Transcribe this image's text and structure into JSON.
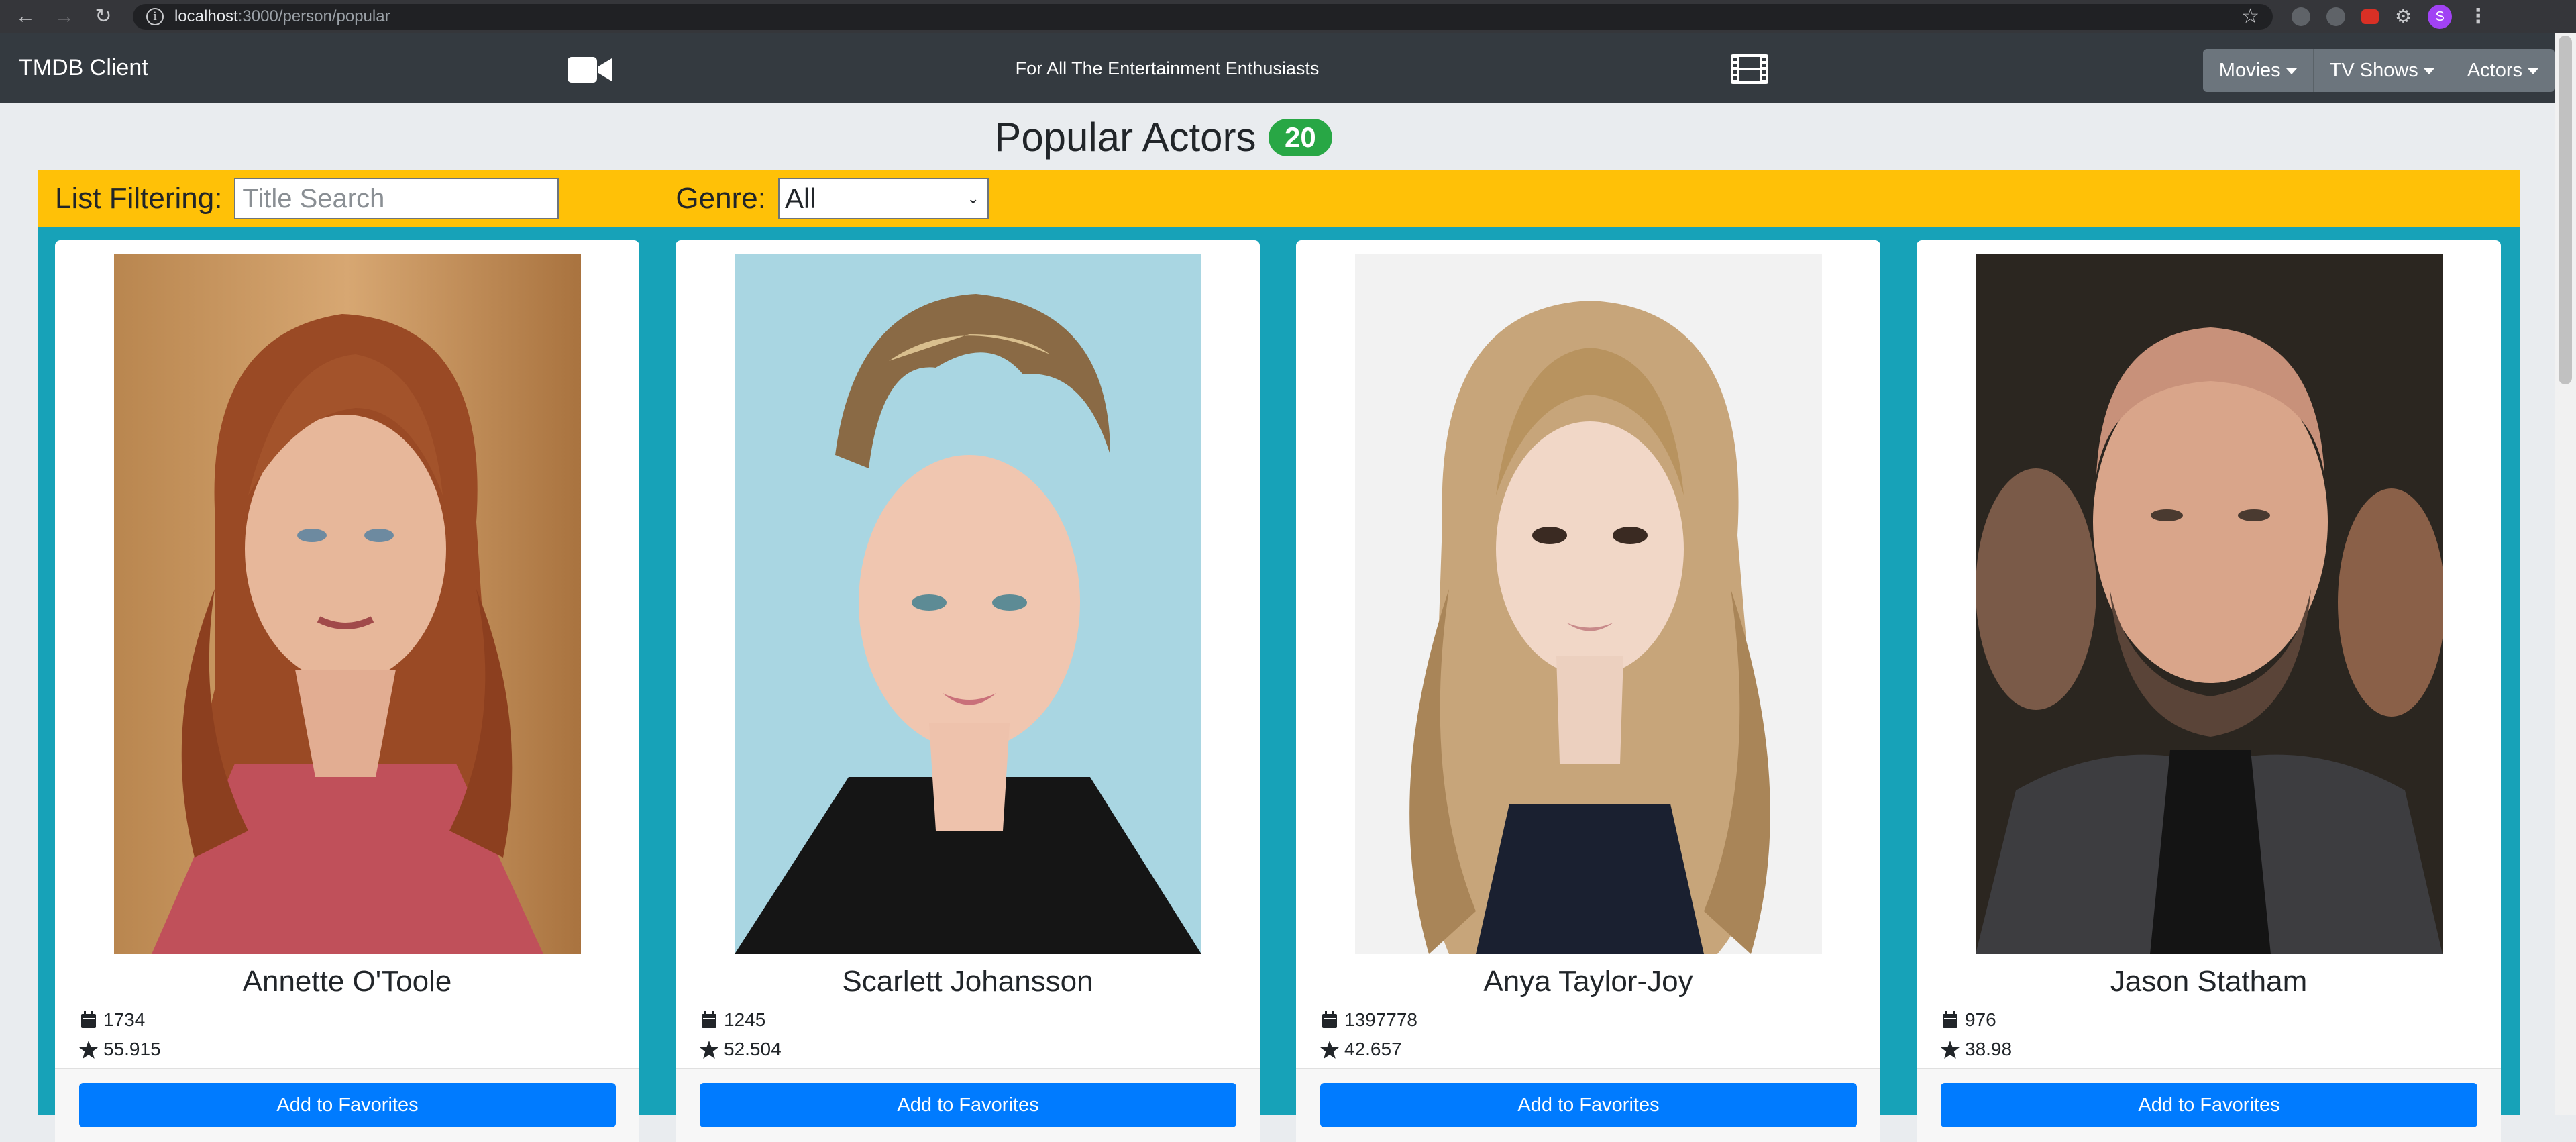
{
  "browser": {
    "url_host": "localhost",
    "url_path": ":3000/person/popular",
    "profile_initial": "S"
  },
  "navbar": {
    "brand": "TMDB Client",
    "tagline": "For All The Entertainment Enthusiasts",
    "menus": [
      "Movies",
      "TV Shows",
      "Actors"
    ]
  },
  "page": {
    "title": "Popular Actors",
    "count": "20"
  },
  "filter": {
    "label": "List Filtering:",
    "search_placeholder": "Title Search",
    "genre_label": "Genre:",
    "genre_value": "All"
  },
  "actors": [
    {
      "name": "Annette O'Toole",
      "stat1": "1734",
      "stat2": "55.915",
      "button": "Add to Favorites"
    },
    {
      "name": "Scarlett Johansson",
      "stat1": "1245",
      "stat2": "52.504",
      "button": "Add to Favorites"
    },
    {
      "name": "Anya Taylor-Joy",
      "stat1": "1397778",
      "stat2": "42.657",
      "button": "Add to Favorites"
    },
    {
      "name": "Jason Statham",
      "stat1": "976",
      "stat2": "38.98",
      "button": "Add to Favorites"
    }
  ],
  "colors": {
    "navbar": "#343a40",
    "filter_bar": "#ffc107",
    "grid_bg": "#17a2b8",
    "badge": "#28a745",
    "button": "#007bff"
  }
}
